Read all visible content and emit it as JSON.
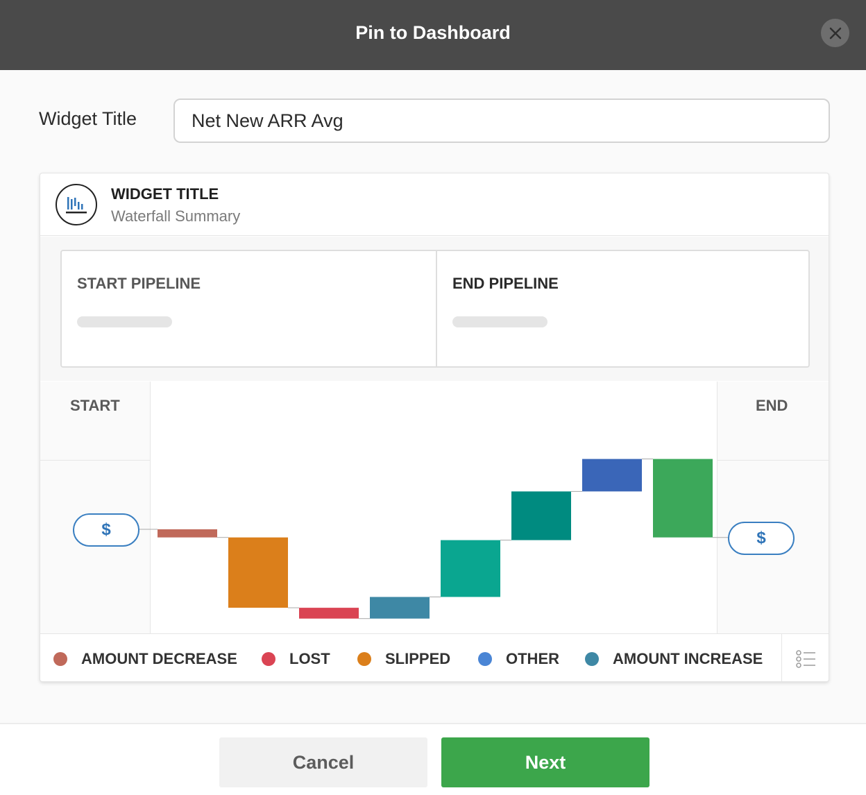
{
  "header": {
    "title": "Pin to Dashboard",
    "close_icon": "close-icon"
  },
  "form": {
    "widget_title_label": "Widget Title",
    "widget_title_value": "Net New ARR Avg"
  },
  "card": {
    "icon": "waterfall-chart-icon",
    "title": "WIDGET TITLE",
    "subtitle": "Waterfall Summary",
    "start_pipeline_label": "START PIPELINE",
    "end_pipeline_label": "END PIPELINE",
    "start_label": "START",
    "end_label": "END",
    "start_value": "$",
    "end_value": "$"
  },
  "chart_data": {
    "type": "bar",
    "subtype": "waterfall",
    "colors": {
      "amount_decrease": "#c0695a",
      "lost": "#da4453",
      "slipped": "#db7f1b",
      "other": "#4a85d5",
      "amount_increase": "#3e88a5"
    },
    "bars": [
      {
        "category": "amount_decrease",
        "start": 0,
        "end": -3,
        "color": "#c0695a"
      },
      {
        "category": "slipped",
        "start": -3,
        "end": -29,
        "color": "#db7f1b"
      },
      {
        "category": "lost",
        "start": -29,
        "end": -33,
        "color": "#da4453"
      },
      {
        "category": "amount_increase",
        "start": -33,
        "end": -25,
        "color": "#3e88a5"
      },
      {
        "category": "increase",
        "start": -25,
        "end": -4,
        "color": "#0aa690"
      },
      {
        "category": "increase",
        "start": -4,
        "end": 14,
        "color": "#008b80"
      },
      {
        "category": "increase",
        "start": 14,
        "end": 26,
        "color": "#3a66b8"
      },
      {
        "category": "end",
        "start": 26,
        "end": -3,
        "color": "#3ca85a"
      }
    ],
    "legend": [
      {
        "label": "AMOUNT DECREASE",
        "color": "#c0695a"
      },
      {
        "label": "LOST",
        "color": "#da4453"
      },
      {
        "label": "SLIPPED",
        "color": "#db7f1b"
      },
      {
        "label": "OTHER",
        "color": "#4a85d5"
      },
      {
        "label": "AMOUNT INCREASE",
        "color": "#3e88a5"
      }
    ]
  },
  "legend_toggle_icon": "list-icon",
  "footer": {
    "cancel_label": "Cancel",
    "next_label": "Next"
  }
}
